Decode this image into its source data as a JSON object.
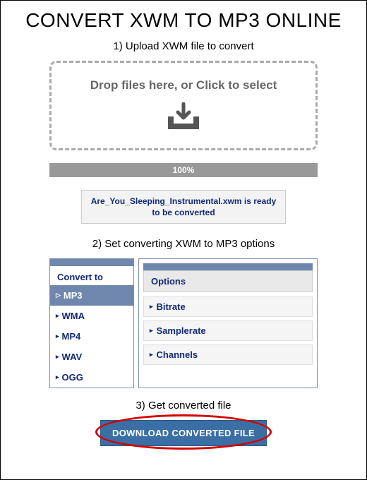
{
  "title": "CONVERT XWM TO MP3 ONLINE",
  "step1": "1) Upload XWM file to convert",
  "dropzone_text": "Drop files here, or Click to select",
  "progress_text": "100%",
  "file_status": "Are_You_Sleeping_Instrumental.xwm is ready to be converted",
  "step2": "2) Set converting XWM to MP3 options",
  "formats_title": "Convert to",
  "formats": [
    {
      "label": "MP3",
      "active": true
    },
    {
      "label": "WMA",
      "active": false
    },
    {
      "label": "MP4",
      "active": false
    },
    {
      "label": "WAV",
      "active": false
    },
    {
      "label": "OGG",
      "active": false
    }
  ],
  "options_header": "Options",
  "options": [
    "Bitrate",
    "Samplerate",
    "Channels"
  ],
  "step3": "3) Get converted file",
  "download_label": "DOWNLOAD CONVERTED FILE"
}
